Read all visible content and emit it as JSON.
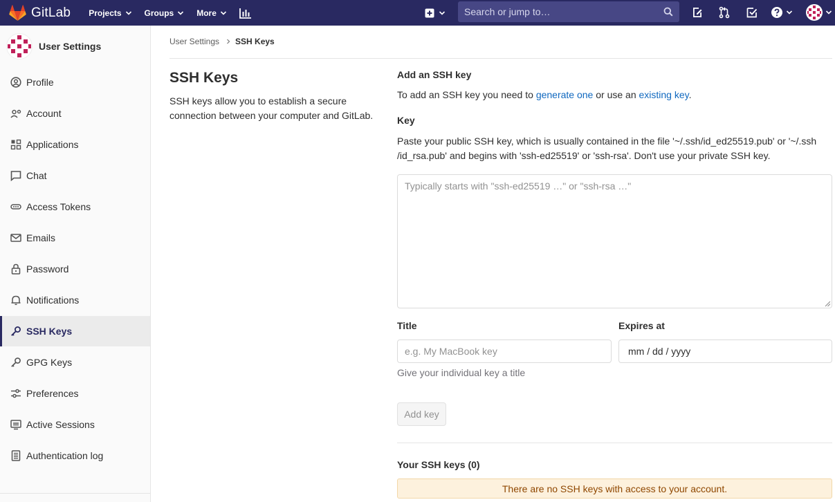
{
  "navbar": {
    "brand": "GitLab",
    "menu": [
      {
        "label": "Projects"
      },
      {
        "label": "Groups"
      },
      {
        "label": "More"
      }
    ],
    "search_placeholder": "Search or jump to…"
  },
  "sidebar": {
    "title": "User Settings",
    "items": [
      {
        "label": "Profile",
        "icon": "profile-icon"
      },
      {
        "label": "Account",
        "icon": "account-icon"
      },
      {
        "label": "Applications",
        "icon": "applications-icon"
      },
      {
        "label": "Chat",
        "icon": "chat-icon"
      },
      {
        "label": "Access Tokens",
        "icon": "token-icon"
      },
      {
        "label": "Emails",
        "icon": "mail-icon"
      },
      {
        "label": "Password",
        "icon": "lock-icon"
      },
      {
        "label": "Notifications",
        "icon": "bell-icon"
      },
      {
        "label": "SSH Keys",
        "icon": "key-icon",
        "active": true
      },
      {
        "label": "GPG Keys",
        "icon": "key-icon"
      },
      {
        "label": "Preferences",
        "icon": "preferences-icon"
      },
      {
        "label": "Active Sessions",
        "icon": "monitor-icon"
      },
      {
        "label": "Authentication log",
        "icon": "log-icon"
      }
    ]
  },
  "breadcrumb": {
    "parent": "User Settings",
    "current": "SSH Keys"
  },
  "page": {
    "title": "SSH Keys",
    "description": "SSH keys allow you to establish a secure connection between your computer and GitLab."
  },
  "form": {
    "heading": "Add an SSH key",
    "intro_prefix": "To add an SSH key you need to ",
    "intro_link1": "generate one",
    "intro_middle": " or use an ",
    "intro_link2": "existing key",
    "intro_suffix": ".",
    "key_label": "Key",
    "key_help": "Paste your public SSH key, which is usually contained in the file '~/.ssh/id_ed25519.pub' or '~/.ssh /id_rsa.pub' and begins with 'ssh-ed25519' or 'ssh-rsa'. Don't use your private SSH key.",
    "key_placeholder": "Typically starts with \"ssh-ed25519 …\" or \"ssh-rsa …\"",
    "title_label": "Title",
    "title_placeholder": "e.g. My MacBook key",
    "title_help": "Give your individual key a title",
    "expires_label": "Expires at",
    "expires_value": "mm / dd / yyyy",
    "submit_label": "Add key"
  },
  "keys": {
    "heading": "Your SSH keys (0)",
    "empty_message": "There are no SSH keys with access to your account."
  },
  "colors": {
    "navbar": "#292961",
    "search_bg": "#474785",
    "link": "#1068bf",
    "alert_bg": "#fdf1dd",
    "alert_text": "#8f4700"
  }
}
